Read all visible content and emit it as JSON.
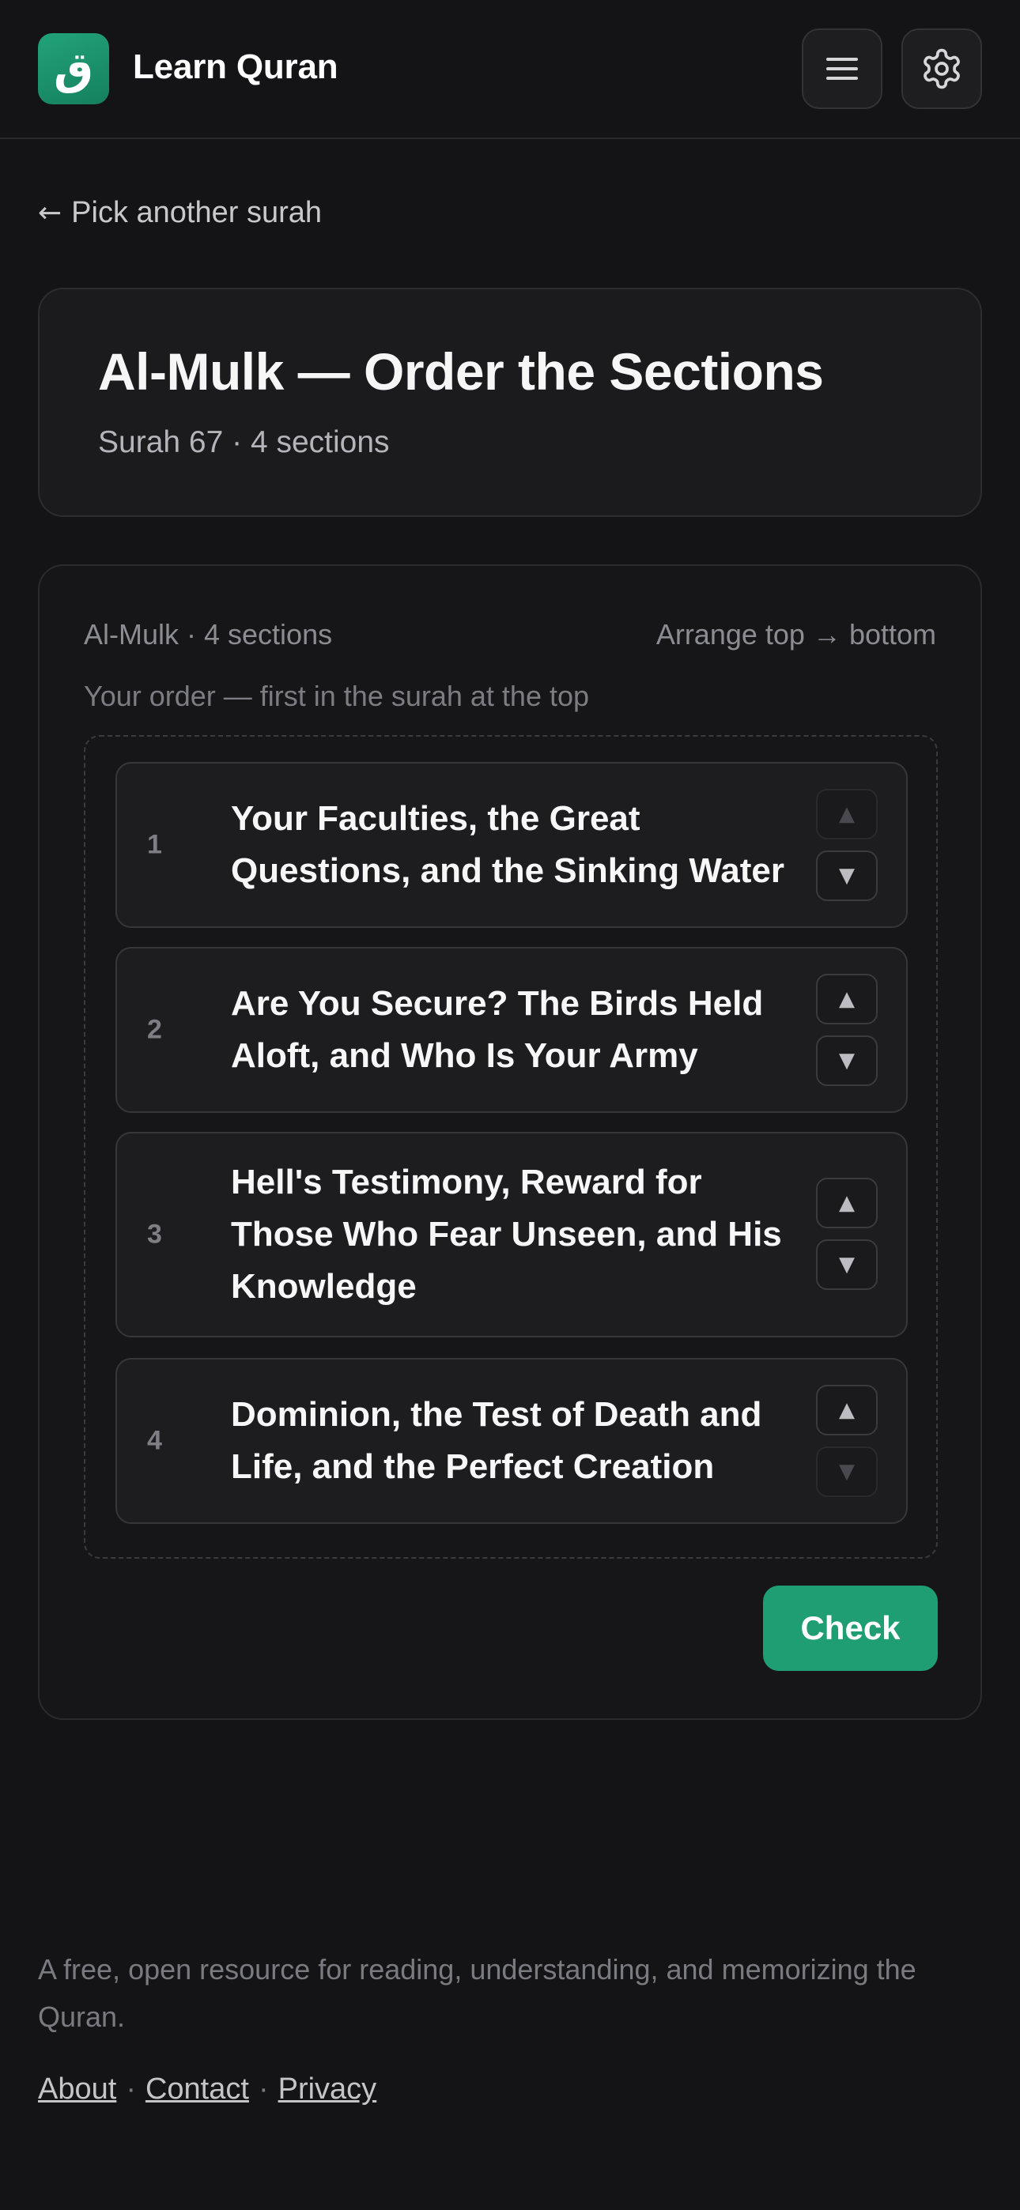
{
  "header": {
    "logo_glyph": "ق",
    "app_title": "Learn Quran",
    "menu_icon": "hamburger-menu-icon",
    "settings_icon": "gear-icon"
  },
  "back_link": {
    "arrow": "←",
    "label": "Pick another surah"
  },
  "title_card": {
    "title": "Al-Mulk — Order the Sections",
    "subtitle": "Surah 67 · 4 sections"
  },
  "exercise": {
    "meta_left": "Al-Mulk · 4 sections",
    "meta_right": "Arrange top → bottom",
    "order_hint": "Your order — first in the surah at the top",
    "sections": [
      {
        "number": "1",
        "title": "Your Faculties, the Great Questions, and the Sinking Water",
        "up_enabled": false,
        "down_enabled": true
      },
      {
        "number": "2",
        "title": "Are You Secure? The Birds Held Aloft, and Who Is Your Army",
        "up_enabled": true,
        "down_enabled": true
      },
      {
        "number": "3",
        "title": "Hell's Testimony, Reward for Those Who Fear Unseen, and His Knowledge",
        "up_enabled": true,
        "down_enabled": true
      },
      {
        "number": "4",
        "title": "Dominion, the Test of Death and Life, and the Perfect Creation",
        "up_enabled": true,
        "down_enabled": false
      }
    ],
    "up_glyph": "▲",
    "down_glyph": "▼",
    "check_label": "Check"
  },
  "footer": {
    "text": "A free, open resource for reading, understanding, and memorizing the Quran.",
    "links": [
      "About",
      "Contact",
      "Privacy"
    ],
    "separator": "·"
  },
  "colors": {
    "background": "#141416",
    "accent": "#1f9e74",
    "card": "#1b1b1e"
  }
}
